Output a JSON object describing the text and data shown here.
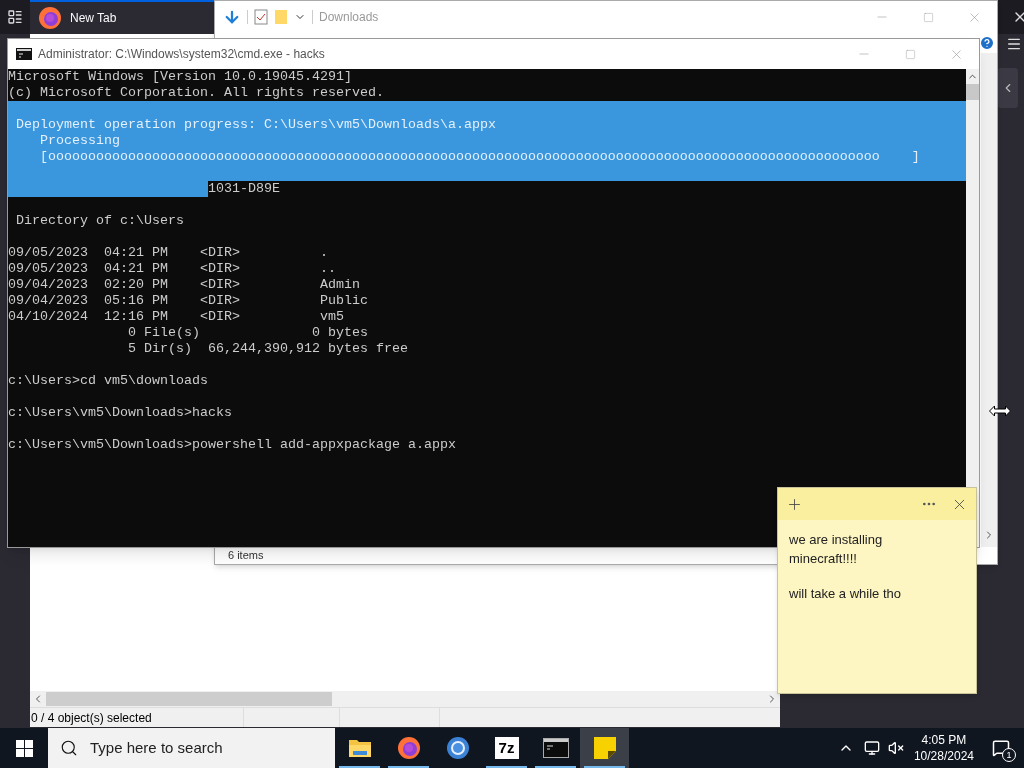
{
  "browser": {
    "tabs": [
      {
        "label": "New Tab",
        "selected": true
      }
    ]
  },
  "archive_window": {
    "status": "0 / 4 object(s) selected"
  },
  "explorer": {
    "title": "Downloads",
    "active": false,
    "status": "6 items"
  },
  "console": {
    "title": "Administrator: C:\\Windows\\system32\\cmd.exe - hacks",
    "header_lines": [
      "Microsoft Windows [Version 10.0.19045.4291]",
      "(c) Microsoft Corporation. All rights reserved."
    ],
    "progress": {
      "heading": " Deployment operation progress: C:\\Users\\vm5\\Downloads\\a.appx",
      "status": "    Processing",
      "bar": "    [oooooooooooooooooooooooooooooooooooooooooooooooooooooooooooooooooooooooooooooooooooooooooooooooooooooooo    ]"
    },
    "cut_line": "1031-D89E",
    "blocks": [
      [
        " Directory of c:\\Users"
      ],
      [
        "09/05/2023  04:21 PM    <DIR>          .",
        "09/05/2023  04:21 PM    <DIR>          ..",
        "09/04/2023  02:20 PM    <DIR>          Admin",
        "09/04/2023  05:16 PM    <DIR>          Public",
        "04/10/2024  12:16 PM    <DIR>          vm5",
        "               0 File(s)              0 bytes",
        "               5 Dir(s)  66,244,390,912 bytes free"
      ],
      [
        "c:\\Users>cd vm5\\downloads"
      ],
      [
        "c:\\Users\\vm5\\Downloads>hacks"
      ],
      [
        "c:\\Users\\vm5\\Downloads>powershell add-appxpackage a.appx"
      ]
    ]
  },
  "sticky_note": {
    "paragraphs": [
      "we are installing minecraft!!!!",
      "will take a while tho"
    ]
  },
  "taskbar": {
    "search_placeholder": "Type here to search",
    "apps": [
      {
        "kind": "explorer",
        "running": true,
        "selected": false
      },
      {
        "kind": "firefox",
        "running": true,
        "selected": false
      },
      {
        "kind": "chrome",
        "running": false,
        "selected": false
      },
      {
        "kind": "archiver",
        "label": "7z",
        "running": true,
        "selected": false
      },
      {
        "kind": "terminal",
        "running": true,
        "selected": false
      },
      {
        "kind": "sticky_notes",
        "running": true,
        "selected": true
      }
    ],
    "time": "4:05 PM",
    "date": "10/28/2024",
    "notifications": "1"
  }
}
